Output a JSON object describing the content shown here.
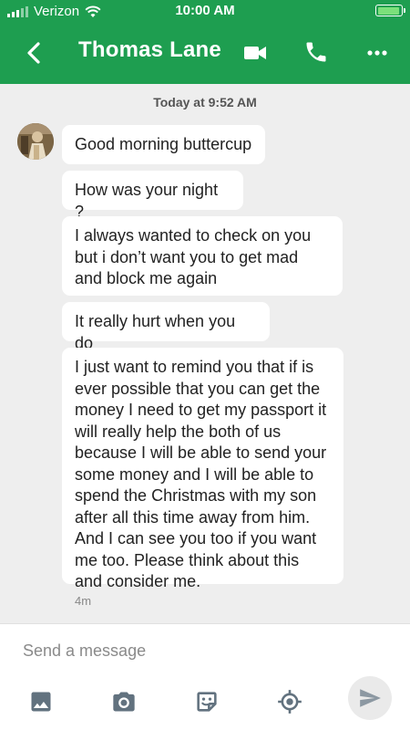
{
  "status": {
    "carrier": "Verizon",
    "time": "10:00 AM",
    "battery_level": 0.95
  },
  "header": {
    "title": "Thomas Lane",
    "icons": [
      "back-chevron-icon",
      "video-camera-icon",
      "phone-icon",
      "more-dots-icon"
    ]
  },
  "conversation": {
    "date_label": "Today at 9:52 AM",
    "messages": [
      "Good morning buttercup",
      "How was your night ?",
      "I always wanted to check on you but i don’t want you to get mad and block me again",
      "It really hurt when you do",
      "I just want to remind you that if is ever possible that you can get the money I need to get my passport it will really help the both of us because I will be able to send your some money and I will be able to spend the Christmas with my son after all this time away from him. And I can see you too if you want me too. Please think about this and consider me."
    ],
    "time_ago": "4m"
  },
  "composer": {
    "placeholder": "Send a message",
    "tools": [
      "image-icon",
      "camera-icon",
      "sticker-icon",
      "location-icon"
    ],
    "send_icon": "send-icon"
  },
  "colors": {
    "brand_green": "#1e9e50",
    "background": "#eeeeee",
    "bubble": "#ffffff"
  }
}
